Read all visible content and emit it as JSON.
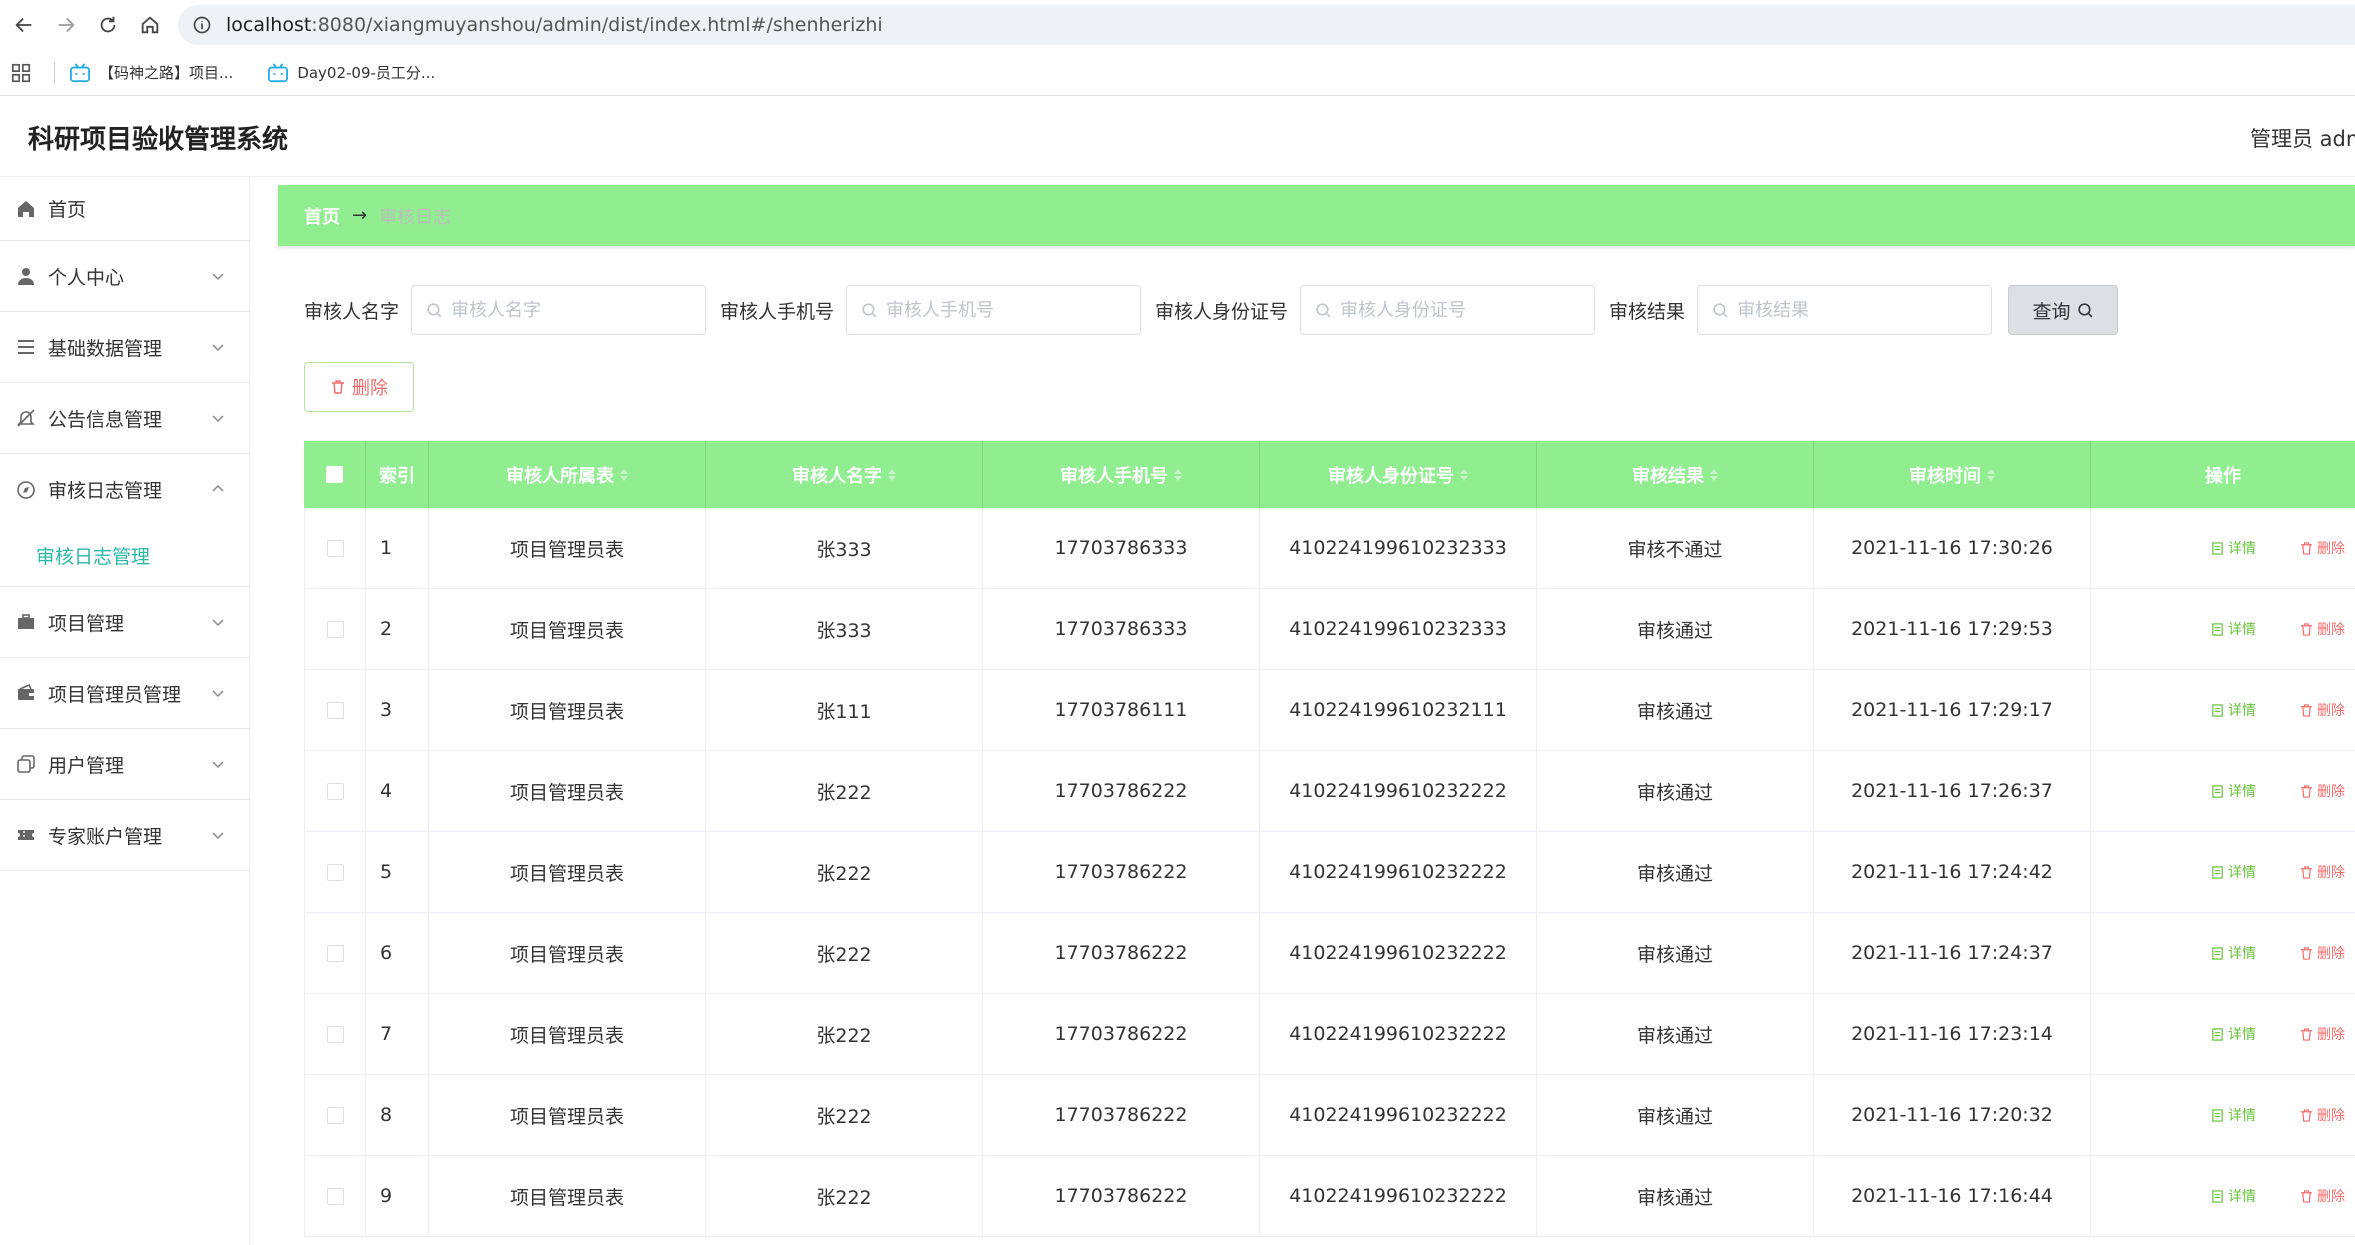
{
  "browser": {
    "url_host": "localhost",
    "url_path": ":8080/xiangmuyanshou/admin/dist/index.html#/shenherizhi",
    "bookmarks": [
      {
        "label": "【码神之路】项目..."
      },
      {
        "label": "Day02-09-员工分..."
      }
    ]
  },
  "header": {
    "title": "科研项目验收管理系统",
    "user": "管理员 adm"
  },
  "sidebar": {
    "items": [
      {
        "label": "首页",
        "icon": "home-icon"
      },
      {
        "label": "个人中心",
        "icon": "user-icon"
      },
      {
        "label": "基础数据管理",
        "icon": "list-icon"
      },
      {
        "label": "公告信息管理",
        "icon": "bell-off-icon"
      },
      {
        "label": "审核日志管理",
        "icon": "compass-icon"
      },
      {
        "label": "项目管理",
        "icon": "briefcase-icon"
      },
      {
        "label": "项目管理员管理",
        "icon": "wallet-icon"
      },
      {
        "label": "用户管理",
        "icon": "copy-icon"
      },
      {
        "label": "专家账户管理",
        "icon": "ticket-icon"
      }
    ],
    "open_sub": "审核日志管理"
  },
  "breadcrumb": {
    "home": "首页",
    "separator": "→",
    "current": "审核日志"
  },
  "search": {
    "fields": [
      {
        "label": "审核人名字",
        "placeholder": "审核人名字"
      },
      {
        "label": "审核人手机号",
        "placeholder": "审核人手机号"
      },
      {
        "label": "审核人身份证号",
        "placeholder": "审核人身份证号"
      },
      {
        "label": "审核结果",
        "placeholder": "审核结果"
      }
    ],
    "query_label": "查询"
  },
  "actions": {
    "delete_label": "删除"
  },
  "table": {
    "headers": [
      "索引",
      "审核人所属表",
      "审核人名字",
      "审核人手机号",
      "审核人身份证号",
      "审核结果",
      "审核时间",
      "操作"
    ],
    "detail_label": "详情",
    "delete_label": "删除",
    "rows": [
      {
        "idx": "1",
        "table": "项目管理员表",
        "name": "张333",
        "phone": "17703786333",
        "idcard": "410224199610232333",
        "result": "审核不通过",
        "time": "2021-11-16 17:30:26"
      },
      {
        "idx": "2",
        "table": "项目管理员表",
        "name": "张333",
        "phone": "17703786333",
        "idcard": "410224199610232333",
        "result": "审核通过",
        "time": "2021-11-16 17:29:53"
      },
      {
        "idx": "3",
        "table": "项目管理员表",
        "name": "张111",
        "phone": "17703786111",
        "idcard": "410224199610232111",
        "result": "审核通过",
        "time": "2021-11-16 17:29:17"
      },
      {
        "idx": "4",
        "table": "项目管理员表",
        "name": "张222",
        "phone": "17703786222",
        "idcard": "410224199610232222",
        "result": "审核通过",
        "time": "2021-11-16 17:26:37"
      },
      {
        "idx": "5",
        "table": "项目管理员表",
        "name": "张222",
        "phone": "17703786222",
        "idcard": "410224199610232222",
        "result": "审核通过",
        "time": "2021-11-16 17:24:42"
      },
      {
        "idx": "6",
        "table": "项目管理员表",
        "name": "张222",
        "phone": "17703786222",
        "idcard": "410224199610232222",
        "result": "审核通过",
        "time": "2021-11-16 17:24:37"
      },
      {
        "idx": "7",
        "table": "项目管理员表",
        "name": "张222",
        "phone": "17703786222",
        "idcard": "410224199610232222",
        "result": "审核通过",
        "time": "2021-11-16 17:23:14"
      },
      {
        "idx": "8",
        "table": "项目管理员表",
        "name": "张222",
        "phone": "17703786222",
        "idcard": "410224199610232222",
        "result": "审核通过",
        "time": "2021-11-16 17:20:32"
      },
      {
        "idx": "9",
        "table": "项目管理员表",
        "name": "张222",
        "phone": "17703786222",
        "idcard": "410224199610232222",
        "result": "审核通过",
        "time": "2021-11-16 17:16:44"
      }
    ]
  },
  "colors": {
    "accent_green": "#90ee90",
    "submenu_teal": "#2ab8a9",
    "danger_red": "#f56c6c",
    "success_green": "#67c23a"
  }
}
